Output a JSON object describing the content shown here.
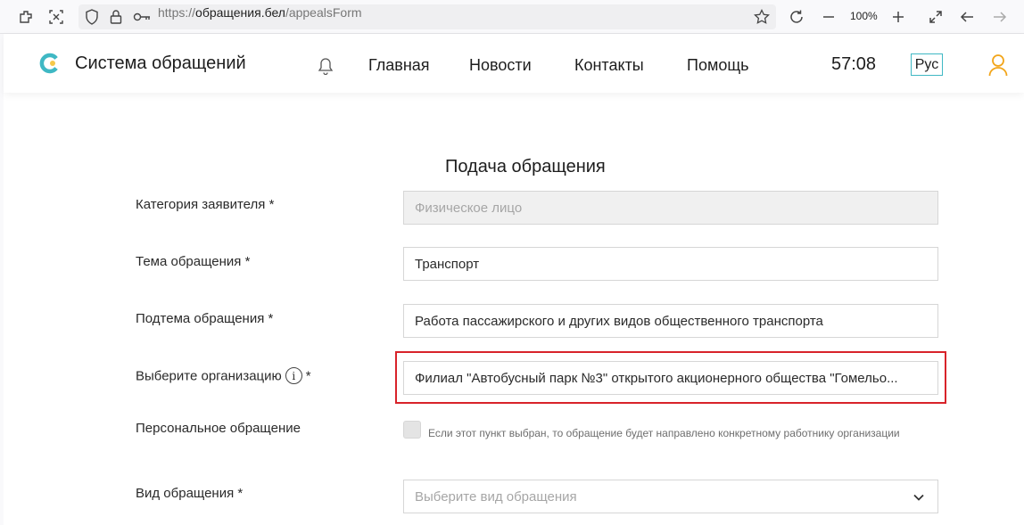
{
  "browser": {
    "url_scheme": "https://",
    "url_domain": "обращения.бел",
    "url_path": "/appealsForm",
    "zoom": "100%"
  },
  "header": {
    "site_title": "Система обращений",
    "nav": [
      "Главная",
      "Новости",
      "Контакты",
      "Помощь"
    ],
    "timer": "57:08",
    "language": "Рус"
  },
  "form": {
    "title": "Подача обращения",
    "applicant_category_label": "Категория заявителя *",
    "applicant_category_value": "Физическое лицо",
    "topic_label": "Тема обращения *",
    "topic_value": "Транспорт",
    "subtopic_label": "Подтема обращения *",
    "subtopic_value": "Работа пассажирского и других видов общественного транспорта",
    "organization_label": "Выберите организацию",
    "organization_required": "*",
    "organization_info": "i",
    "organization_value": "Филиал \"Автобусный парк №3\" открытого акционерного общества \"Гомельо...",
    "personal_label": "Персональное обращение",
    "personal_hint": "Если этот пункт выбран, то обращение будет направлено конкретному работнику организации",
    "appeal_type_label": "Вид обращения *",
    "appeal_type_placeholder": "Выберите вид обращения"
  },
  "colors": {
    "accent": "#3fb8c4",
    "highlight": "#d8232a",
    "user_icon": "#f2a51a"
  }
}
